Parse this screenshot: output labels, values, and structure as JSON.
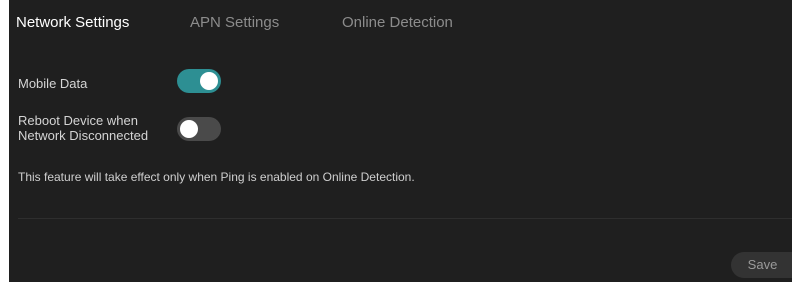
{
  "tabs": [
    {
      "label": "Network Settings",
      "active": true
    },
    {
      "label": "APN Settings",
      "active": false
    },
    {
      "label": "Online Detection",
      "active": false
    }
  ],
  "settings": {
    "mobile_data": {
      "label": "Mobile Data",
      "enabled": true
    },
    "reboot_on_disconnect": {
      "label_line1": "Reboot Device when",
      "label_line2": "Network Disconnected",
      "enabled": false
    }
  },
  "note": "This feature will take effect only when Ping is enabled on Online Detection.",
  "actions": {
    "save_label": "Save"
  },
  "colors": {
    "background": "#1f1f1f",
    "toggle_on": "#2d8f93",
    "toggle_off": "#4a4a4a",
    "active_tab": "#ffffff",
    "inactive_tab": "#8c8c8c"
  }
}
